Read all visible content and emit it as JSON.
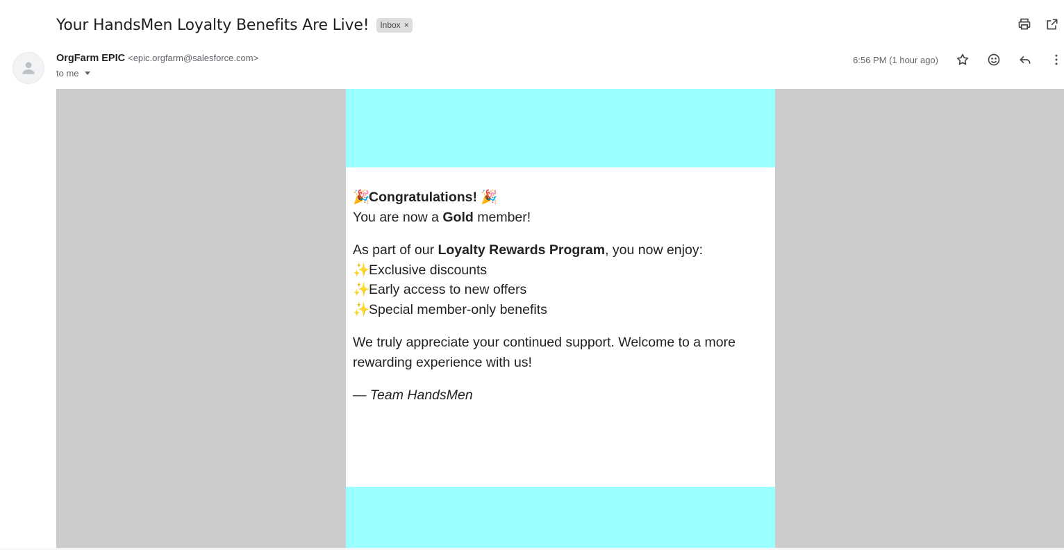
{
  "email": {
    "subject": "Your HandsMen Loyalty Benefits Are Live!",
    "label": "Inbox",
    "label_remove": "×",
    "sender_name": "OrgFarm EPIC",
    "sender_email": "<epic.orgfarm@salesforce.com>",
    "recipient": "to me",
    "timestamp": "6:56 PM (1 hour ago)"
  },
  "icons": {
    "print": "printer-icon",
    "popout": "open-in-new-window-icon",
    "star": "star-icon",
    "emoji": "smiley-icon",
    "reply": "reply-icon",
    "more": "more-vert-icon",
    "avatar": "person-icon"
  },
  "body": {
    "congrats_emoji_left": "🎉",
    "congrats_text": "Congratulations!",
    "congrats_emoji_right": "🎉",
    "member_prefix": "You are now a ",
    "member_tier": "Gold",
    "member_suffix": " member!",
    "program_prefix": "As part of our ",
    "program_name": "Loyalty Rewards Program",
    "program_suffix": ", you now enjoy:",
    "benefit_bullet": "✨",
    "benefits": [
      "Exclusive discounts",
      "Early access to new offers",
      "Special member-only benefits"
    ],
    "appreciation": "We truly appreciate your continued support. Welcome to a more rewarding experience with us!",
    "signature": "— Team HandsMen"
  },
  "colors": {
    "band": "#99ffff",
    "canvas": "#cccccc",
    "card": "#ffffff"
  }
}
